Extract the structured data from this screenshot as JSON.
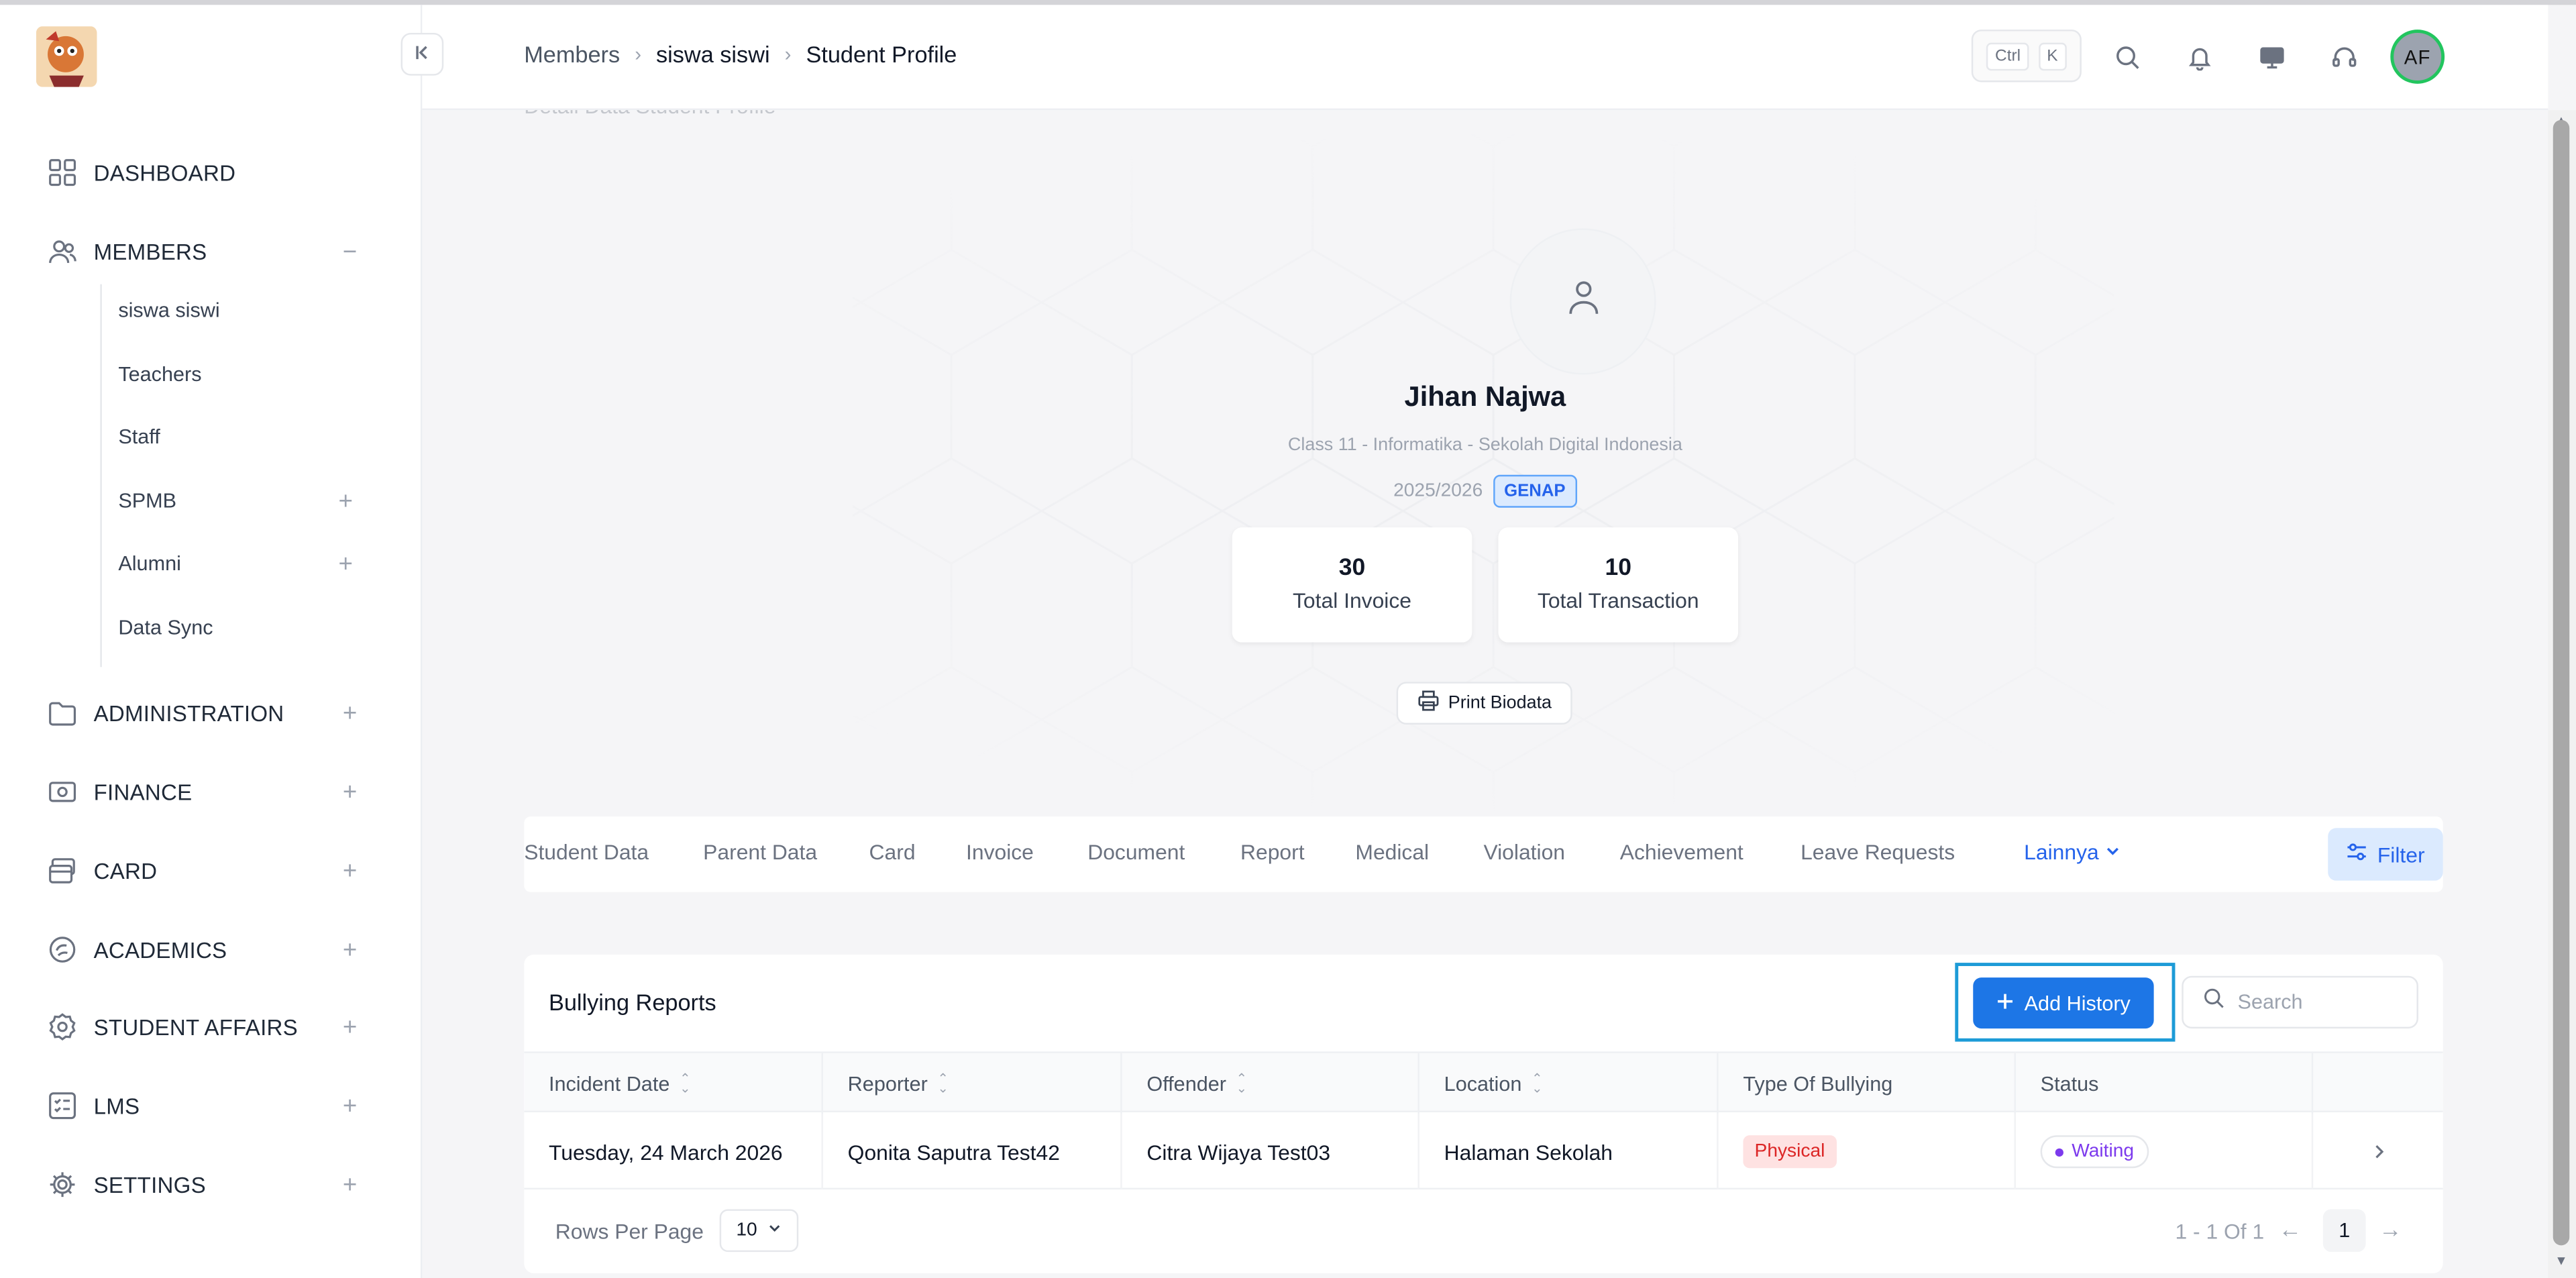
{
  "sidebar": {
    "collapse_icon": "chevrons-left-icon",
    "items": [
      {
        "label": "DASHBOARD",
        "icon": "grid-icon"
      },
      {
        "label": "MEMBERS",
        "icon": "users-icon",
        "state": "−"
      },
      {
        "label": "ADMINISTRATION",
        "icon": "folder-icon",
        "state": "+"
      },
      {
        "label": "FINANCE",
        "icon": "money-icon",
        "state": "+"
      },
      {
        "label": "CARD",
        "icon": "card-icon",
        "state": "+"
      },
      {
        "label": "ACADEMICS",
        "icon": "academics-icon",
        "state": "+"
      },
      {
        "label": "STUDENT AFFAIRS",
        "icon": "badge-icon",
        "state": "+"
      },
      {
        "label": "LMS",
        "icon": "checklist-icon",
        "state": "+"
      },
      {
        "label": "SETTINGS",
        "icon": "gear-icon",
        "state": "+"
      }
    ],
    "members_sub": [
      {
        "label": "siswa siswi"
      },
      {
        "label": "Teachers"
      },
      {
        "label": "Staff"
      },
      {
        "label": "SPMB",
        "state": "+"
      },
      {
        "label": "Alumni",
        "state": "+"
      },
      {
        "label": "Data Sync"
      }
    ]
  },
  "header": {
    "breadcrumb": [
      "Members",
      "siswa siswi",
      "Student Profile"
    ],
    "shortcut": [
      "Ctrl",
      "K"
    ],
    "avatar_initials": "AF"
  },
  "profile": {
    "section_title": "Detail Data Student Profile",
    "name": "Jihan Najwa",
    "class_info": "Class 11 - Informatika - Sekolah Digital Indonesia",
    "year": "2025/2026",
    "semester": "GENAP",
    "stats": [
      {
        "value": "30",
        "label": "Total Invoice"
      },
      {
        "value": "10",
        "label": "Total Transaction"
      }
    ],
    "print_label": "Print Biodata"
  },
  "tabs": [
    "Student Data",
    "Parent Data",
    "Card",
    "Invoice",
    "Document",
    "Report",
    "Medical",
    "Violation",
    "Achievement",
    "Leave Requests"
  ],
  "tab_more": "Lainnya",
  "filter_label": "Filter",
  "table": {
    "title": "Bullying Reports",
    "add_label": "Add History",
    "search_placeholder": "Search",
    "columns": [
      "Incident Date",
      "Reporter",
      "Offender",
      "Location",
      "Type Of Bullying",
      "Status"
    ],
    "rows": [
      {
        "incident_date": "Tuesday, 24 March 2026",
        "reporter": "Qonita Saputra Test42",
        "offender": "Citra Wijaya Test03",
        "location": "Halaman Sekolah",
        "type": "Physical",
        "status": "Waiting"
      }
    ],
    "rows_per_page_label": "Rows Per Page",
    "rows_per_page": "10",
    "range": "1 - 1 Of 1",
    "page": "1"
  },
  "colors": {
    "accent": "#1d76e6",
    "focus": "#1d9bd7",
    "physical": "#dc2626",
    "waiting": "#7c3aed",
    "avatar_ring": "#22c55e"
  }
}
